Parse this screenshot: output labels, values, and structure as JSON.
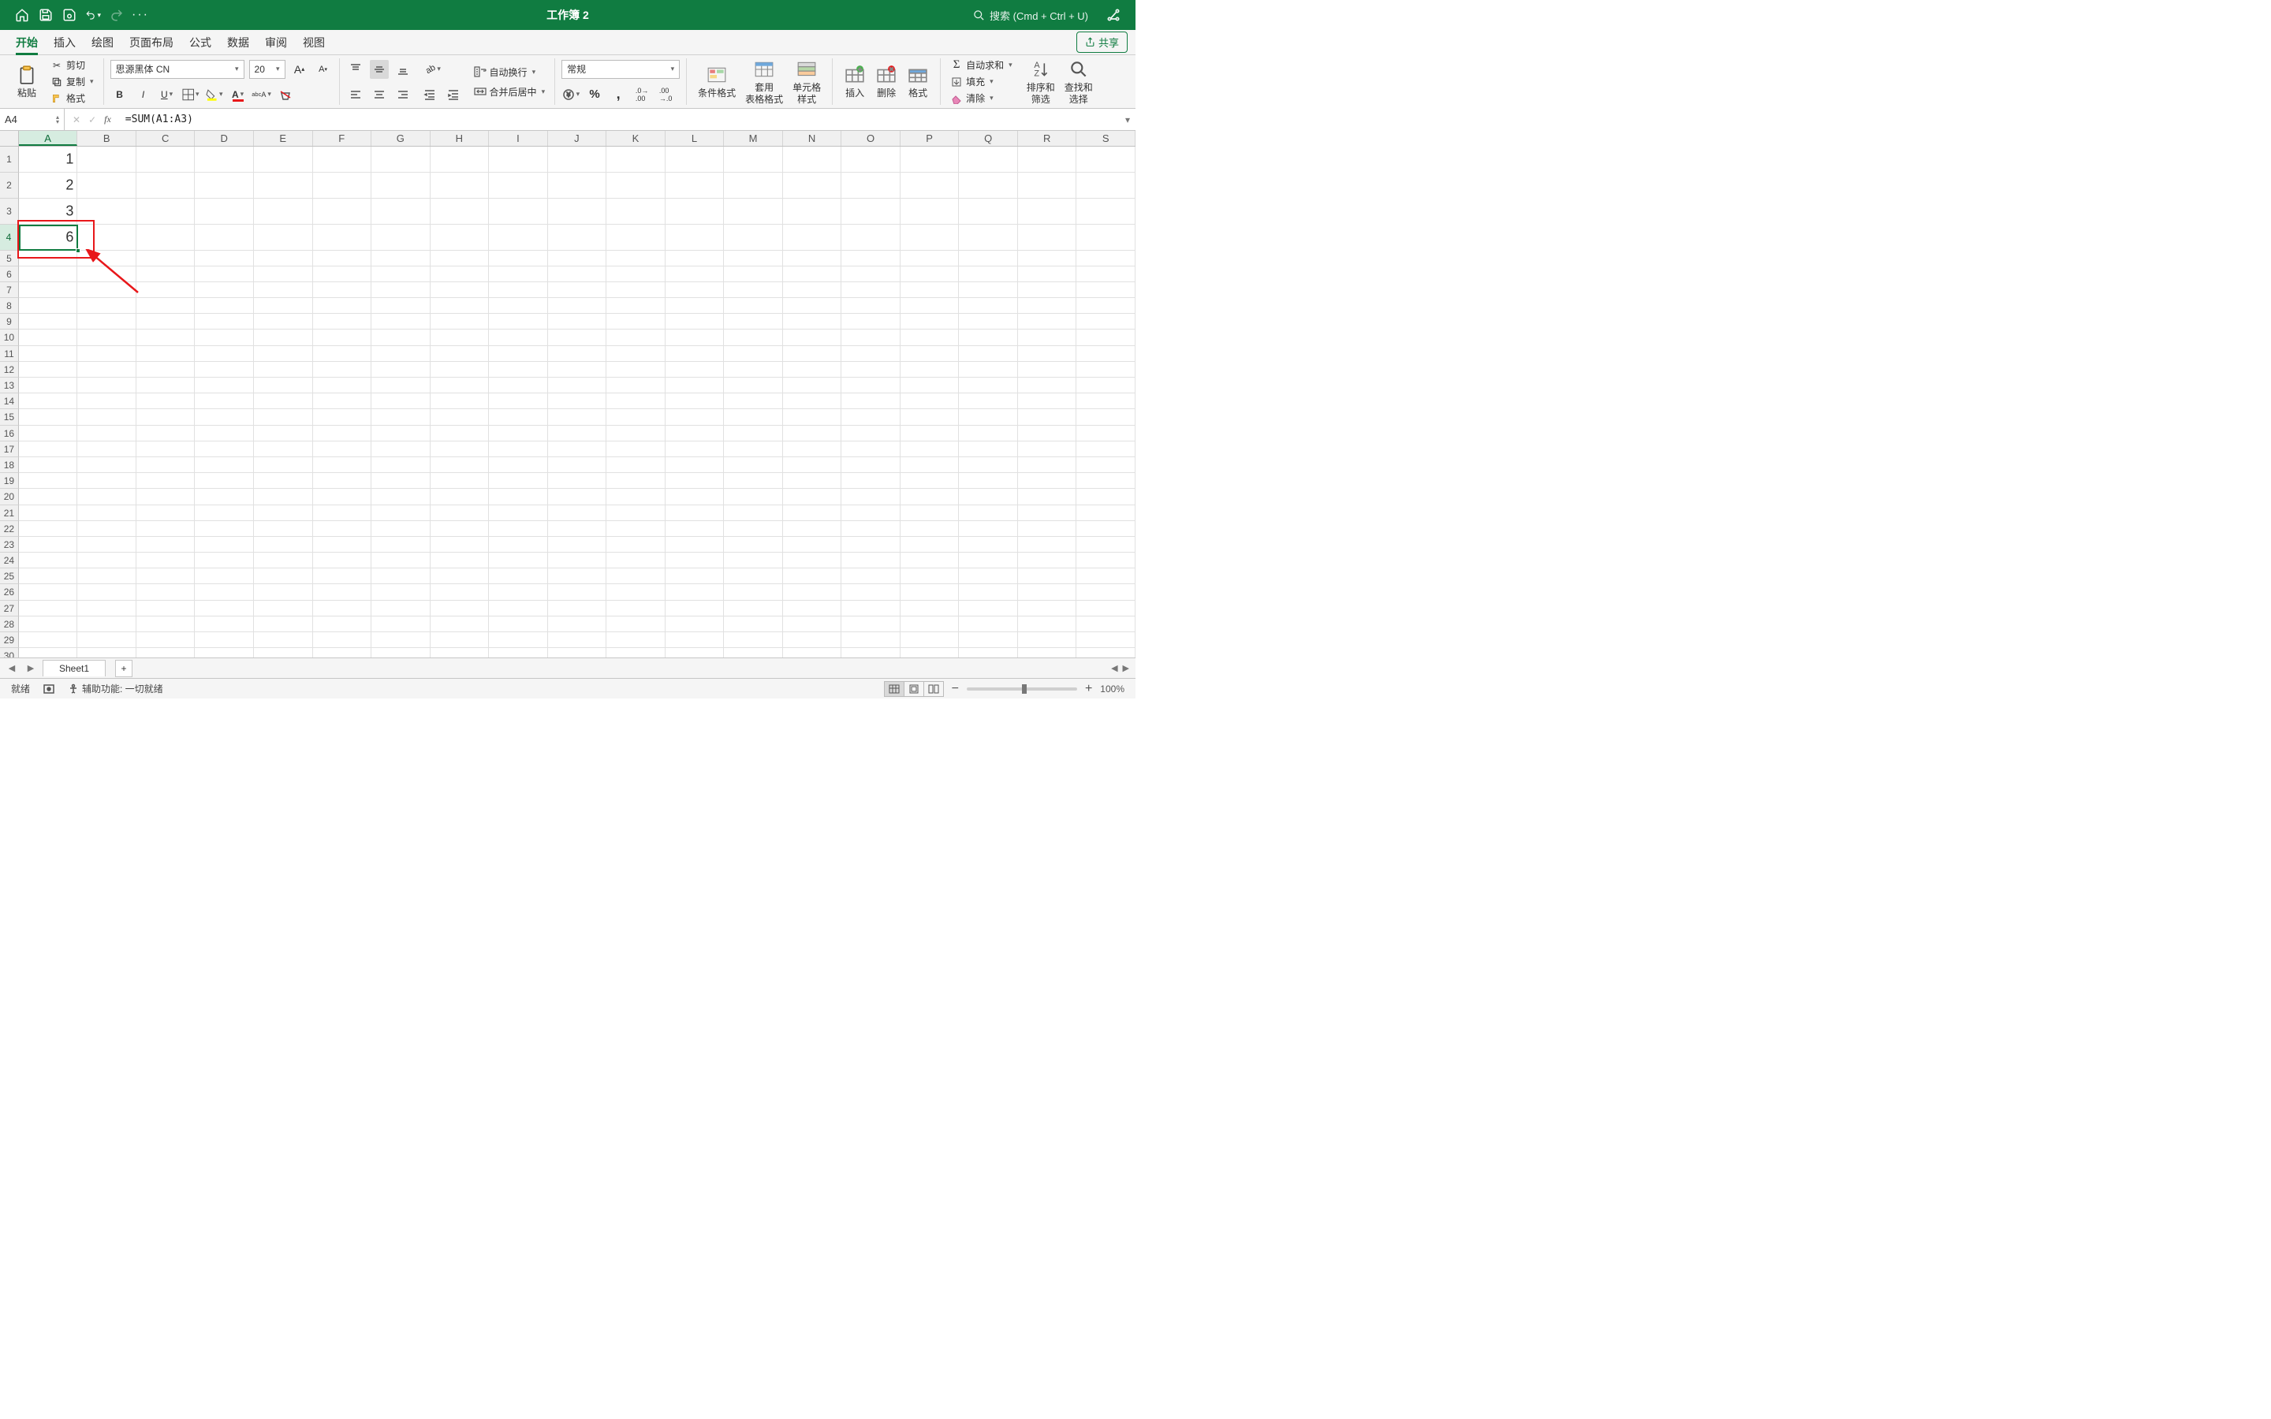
{
  "titlebar": {
    "doc_title": "工作簿 2",
    "search_placeholder": "搜索 (Cmd + Ctrl + U)"
  },
  "tabs": {
    "items": [
      "开始",
      "插入",
      "绘图",
      "页面布局",
      "公式",
      "数据",
      "审阅",
      "视图"
    ],
    "active_index": 0,
    "share_label": "共享"
  },
  "ribbon": {
    "clipboard": {
      "paste": "粘贴",
      "cut": "剪切",
      "copy": "复制",
      "format_painter": "格式"
    },
    "font": {
      "name": "思源黑体 CN",
      "size": "20"
    },
    "alignment": {
      "wrap": "自动换行",
      "merge": "合并后居中"
    },
    "number": {
      "format": "常规"
    },
    "styles": {
      "cond": "条件格式",
      "table": "套用\n表格格式",
      "cell": "单元格\n样式"
    },
    "cells": {
      "insert": "插入",
      "delete": "删除",
      "format": "格式"
    },
    "editing": {
      "autosum": "自动求和",
      "fill": "填充",
      "clear": "清除",
      "sort": "排序和\n筛选",
      "find": "查找和\n选择"
    }
  },
  "formula_bar": {
    "name_box": "A4",
    "formula": "=SUM(A1:A3)"
  },
  "grid": {
    "columns": [
      "A",
      "B",
      "C",
      "D",
      "E",
      "F",
      "G",
      "H",
      "I",
      "J",
      "K",
      "L",
      "M",
      "N",
      "O",
      "P",
      "Q",
      "R",
      "S"
    ],
    "tall_rows": 4,
    "total_rows": 30,
    "active": {
      "col": "A",
      "row": 4
    },
    "cells": {
      "A1": "1",
      "A2": "2",
      "A3": "3",
      "A4": "6"
    }
  },
  "sheets": {
    "items": [
      "Sheet1"
    ],
    "active_index": 0
  },
  "status": {
    "ready": "就绪",
    "accessibility": "辅助功能: 一切就绪",
    "zoom": "100%"
  }
}
